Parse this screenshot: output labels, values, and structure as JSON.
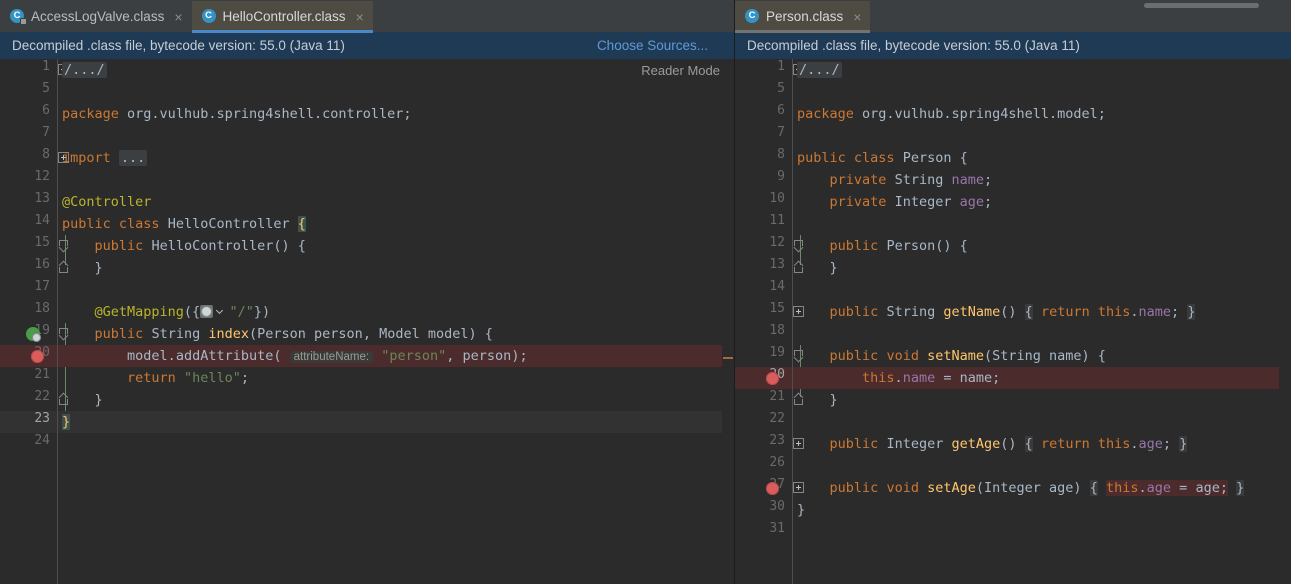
{
  "window": {
    "theme_bg": "#2b2b2b",
    "accent": "#4a88c7",
    "tabstrip_bg": "#3c3f41",
    "infobar_bg": "#1f3a54",
    "link_color": "#5f9ada",
    "breakpoint_color": "#db5c5c",
    "caretline_color": "#323232",
    "bp_line_color": "#4b2b2b"
  },
  "left_pane": {
    "tabs": [
      {
        "label": "AccessLogValve.class",
        "icon": "class-file-locked-icon",
        "close": "×",
        "selected": false
      },
      {
        "label": "HelloController.class",
        "icon": "class-file-icon",
        "close": "×",
        "selected": true
      }
    ],
    "infobar": {
      "text": "Decompiled .class file, bytecode version: 55.0 (Java 11)",
      "link": "Choose Sources..."
    },
    "reader_mode": "Reader Mode",
    "lines": [
      {
        "num": "1",
        "fold": "plus",
        "state": "normal"
      },
      {
        "num": "5",
        "fold": "none",
        "state": "normal"
      },
      {
        "num": "6",
        "fold": "none",
        "state": "normal"
      },
      {
        "num": "7",
        "fold": "none",
        "state": "normal"
      },
      {
        "num": "8",
        "fold": "plus",
        "state": "normal"
      },
      {
        "num": "12",
        "fold": "none",
        "state": "normal"
      },
      {
        "num": "13",
        "fold": "none",
        "state": "normal"
      },
      {
        "num": "14",
        "fold": "none",
        "state": "normal"
      },
      {
        "num": "15",
        "fold": "open",
        "state": "normal"
      },
      {
        "num": "16",
        "fold": "close",
        "state": "normal"
      },
      {
        "num": "17",
        "fold": "none",
        "state": "normal"
      },
      {
        "num": "18",
        "fold": "none",
        "state": "normal"
      },
      {
        "num": "19",
        "fold": "open",
        "state": "normal",
        "gutter_icon": "web-mapping-icon"
      },
      {
        "num": "20",
        "fold": "none",
        "state": "breakpoint",
        "gutter_icon": "breakpoint-icon"
      },
      {
        "num": "21",
        "fold": "none",
        "state": "normal"
      },
      {
        "num": "22",
        "fold": "close",
        "state": "normal"
      },
      {
        "num": "23",
        "fold": "none",
        "state": "caret"
      },
      {
        "num": "24",
        "fold": "none",
        "state": "normal"
      }
    ],
    "code": [
      "/.../",
      "",
      "package org.vulhub.spring4shell.controller;",
      "",
      "import ...",
      "",
      "@Controller",
      "public class HelloController {",
      "    public HelloController() {",
      "    }",
      "",
      "    @GetMapping({\"/\"})",
      "    public String index(Person person, Model model) {",
      "        model.addAttribute( attributeName: \"person\", person);",
      "        return \"hello\";",
      "    }",
      "}",
      ""
    ],
    "hint_labels": {
      "attribute_name": "attributeName:"
    }
  },
  "right_pane": {
    "tabs": [
      {
        "label": "Person.class",
        "icon": "class-file-icon",
        "close": "×",
        "selected": true
      }
    ],
    "infobar": {
      "text": "Decompiled .class file, bytecode version: 55.0 (Java 11)",
      "link": ""
    },
    "lines": [
      {
        "num": "1",
        "fold": "plus",
        "state": "normal"
      },
      {
        "num": "5",
        "fold": "none",
        "state": "normal"
      },
      {
        "num": "6",
        "fold": "none",
        "state": "normal"
      },
      {
        "num": "7",
        "fold": "none",
        "state": "normal"
      },
      {
        "num": "8",
        "fold": "none",
        "state": "normal"
      },
      {
        "num": "9",
        "fold": "none",
        "state": "normal"
      },
      {
        "num": "10",
        "fold": "none",
        "state": "normal"
      },
      {
        "num": "11",
        "fold": "none",
        "state": "normal"
      },
      {
        "num": "12",
        "fold": "open",
        "state": "normal"
      },
      {
        "num": "13",
        "fold": "close",
        "state": "normal"
      },
      {
        "num": "14",
        "fold": "none",
        "state": "normal"
      },
      {
        "num": "15",
        "fold": "plus",
        "state": "normal"
      },
      {
        "num": "18",
        "fold": "none",
        "state": "normal"
      },
      {
        "num": "19",
        "fold": "open",
        "state": "normal"
      },
      {
        "num": "20",
        "fold": "none",
        "state": "breakpoint",
        "gutter_icon": "breakpoint-icon"
      },
      {
        "num": "21",
        "fold": "close",
        "state": "normal"
      },
      {
        "num": "22",
        "fold": "none",
        "state": "normal"
      },
      {
        "num": "23",
        "fold": "plus",
        "state": "normal"
      },
      {
        "num": "26",
        "fold": "none",
        "state": "normal"
      },
      {
        "num": "27",
        "fold": "plus",
        "state": "normal",
        "gutter_icon": "breakpoint-icon"
      },
      {
        "num": "30",
        "fold": "none",
        "state": "normal"
      },
      {
        "num": "31",
        "fold": "none",
        "state": "normal"
      }
    ],
    "code": [
      "/.../",
      "",
      "package org.vulhub.spring4shell.model;",
      "",
      "public class Person {",
      "    private String name;",
      "    private Integer age;",
      "",
      "    public Person() {",
      "    }",
      "",
      "    public String getName() { return this.name; }",
      "",
      "    public void setName(String name) {",
      "        this.name = name;",
      "    }",
      "",
      "    public Integer getAge() { return this.age; }",
      "",
      "    public void setAge(Integer age) { this.age = age; }",
      "}",
      ""
    ]
  }
}
